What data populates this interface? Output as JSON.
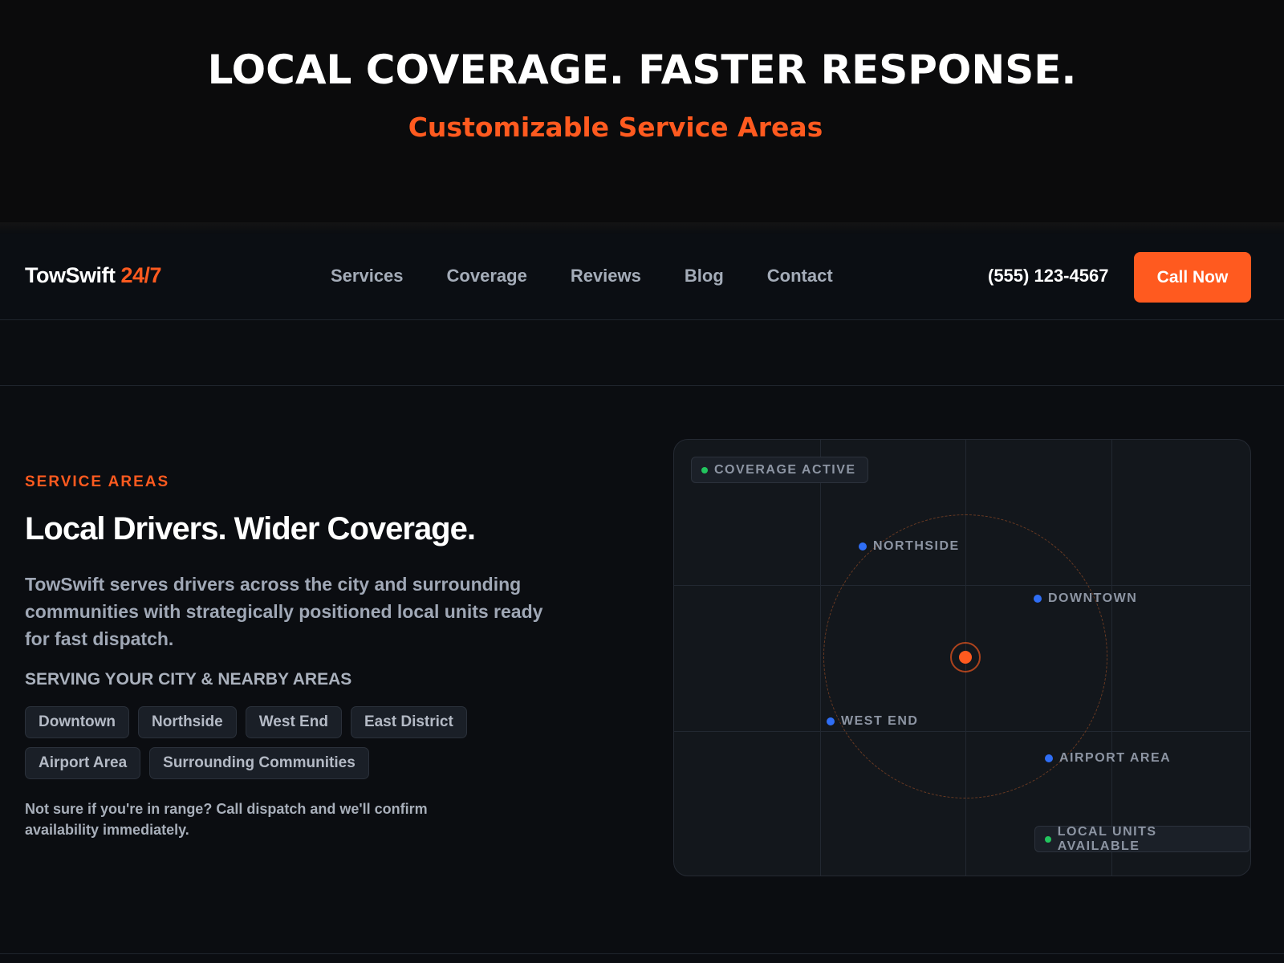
{
  "banner": {
    "title": "LOCAL COVERAGE. FASTER RESPONSE.",
    "subtitle": "Customizable Service Areas"
  },
  "nav": {
    "logo_main": "TowSwift",
    "logo_accent": "24/7",
    "links": [
      "Services",
      "Coverage",
      "Reviews",
      "Blog",
      "Contact"
    ],
    "phone": "(555) 123-4567",
    "cta": "Call Now"
  },
  "section": {
    "eyebrow": "SERVICE AREAS",
    "headline": "Local Drivers. Wider Coverage.",
    "body": "TowSwift serves drivers across the city and surrounding communities with strategically positioned local units ready for fast dispatch.",
    "serving_label": "SERVING YOUR CITY & NEARBY AREAS",
    "chips": [
      "Downtown",
      "Northside",
      "West End",
      "East District",
      "Airport Area",
      "Surrounding Communities"
    ],
    "note": "Not sure if you're in range? Call dispatch and we'll confirm availability immediately."
  },
  "map": {
    "status_badge": "COVERAGE ACTIVE",
    "units_badge": "LOCAL UNITS AVAILABLE",
    "markers": [
      "NORTHSIDE",
      "DOWNTOWN",
      "WEST END",
      "AIRPORT AREA"
    ]
  },
  "colors": {
    "accent": "#ff5a1f",
    "marker": "#2f6ef5",
    "status": "#22c55e"
  }
}
